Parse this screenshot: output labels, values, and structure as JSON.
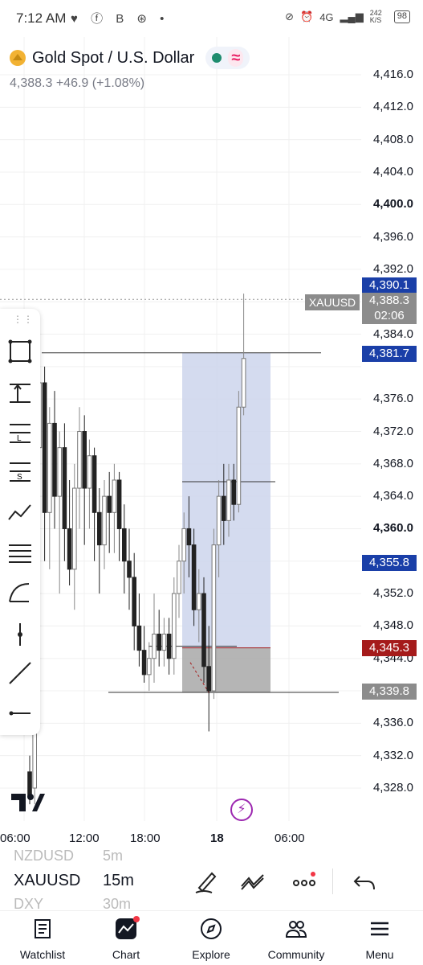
{
  "status_bar": {
    "time": "7:12 AM",
    "network": "4G",
    "speed": "242 K/S",
    "battery": "98"
  },
  "header": {
    "title": "Gold Spot / U.S. Dollar",
    "price_line": "4,388.3  +46.9 (+1.08%)"
  },
  "price_axis": {
    "labels": [
      "4,416.0",
      "4,412.0",
      "4,408.0",
      "4,404.0",
      "4,400.0",
      "4,396.0",
      "4,392.0",
      "4,384.0",
      "4,376.0",
      "4,372.0",
      "4,368.0",
      "4,364.0",
      "4,360.0",
      "4,352.0",
      "4,348.0",
      "4,344.0",
      "4,336.0",
      "4,332.0",
      "4,328.0"
    ],
    "bold_labels": [
      "4,400.0",
      "4,360.0"
    ]
  },
  "price_tags": {
    "top_blue": "4,390.1",
    "current": "4,388.3",
    "countdown": "02:06",
    "symbol_tag": "XAUUSD",
    "target": "4,381.7",
    "entry": "4,355.8",
    "stop": "4,345.3",
    "low": "4,339.8"
  },
  "time_axis": [
    "06:00",
    "12:00",
    "18:00",
    "18",
    "06:00"
  ],
  "chart_data": {
    "type": "candlestick",
    "symbol": "XAUUSD",
    "interval": "15m",
    "ylim": [
      4326,
      4418
    ],
    "last": 4388.3,
    "levels": {
      "high_line": 4381.7,
      "mid_line": 4365.8,
      "low_line": 4339.8,
      "stop": 4345.3,
      "target": 4390.1,
      "entry": 4355.8
    }
  },
  "watchlist_picker": {
    "prev_symbol": "NZDUSD",
    "prev_interval": "5m",
    "current_symbol": "XAUUSD",
    "current_interval": "15m",
    "next_symbol": "DXY",
    "next_interval": "30m"
  },
  "bottom_nav": [
    {
      "label": "Watchlist",
      "icon": "watchlist-icon"
    },
    {
      "label": "Chart",
      "icon": "chart-icon"
    },
    {
      "label": "Explore",
      "icon": "compass-icon"
    },
    {
      "label": "Community",
      "icon": "community-icon"
    },
    {
      "label": "Menu",
      "icon": "menu-icon"
    }
  ],
  "colors": {
    "blue_tag": "#1a3fa8",
    "red_tag": "#a51b1b",
    "gray_tag": "#8c8c8c",
    "zone_blue": "#cdd5ec",
    "zone_gray": "#a8a8a8",
    "accent_red": "#f23645"
  }
}
